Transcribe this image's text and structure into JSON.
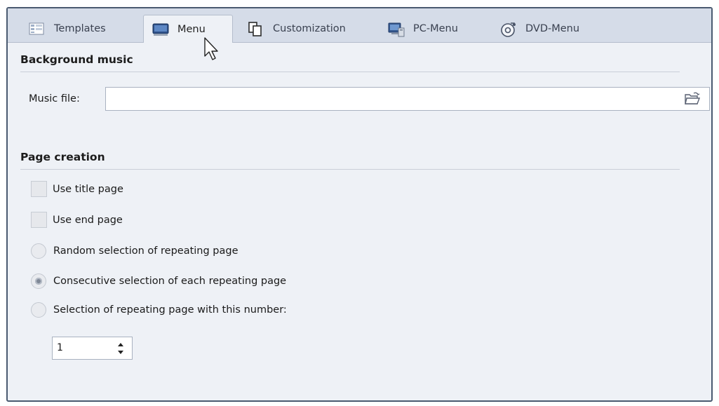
{
  "tabs": [
    {
      "label": "Templates",
      "icon": "templates-icon"
    },
    {
      "label": "Menu",
      "icon": "monitor-icon",
      "active": true
    },
    {
      "label": "Customization",
      "icon": "copy-pages-icon"
    },
    {
      "label": "PC-Menu",
      "icon": "pc-menu-icon"
    },
    {
      "label": "DVD-Menu",
      "icon": "dvd-icon"
    }
  ],
  "background_music": {
    "title": "Background music",
    "music_file_label": "Music file:",
    "music_file_value": "",
    "browse_icon": "folder-open-icon"
  },
  "page_creation": {
    "title": "Page creation",
    "use_title_page": "Use title page",
    "use_title_page_checked": false,
    "use_end_page": "Use end page",
    "use_end_page_checked": false,
    "random_selection": "Random selection of repeating page",
    "consecutive_selection": "Consecutive selection of each repeating page",
    "number_selection": "Selection of repeating page with this number:",
    "selected_option": "consecutive_selection",
    "page_number": "1"
  },
  "colors": {
    "tabbar": "#d5dce8",
    "panel": "#eef1f6",
    "border": "#4a5a70"
  }
}
